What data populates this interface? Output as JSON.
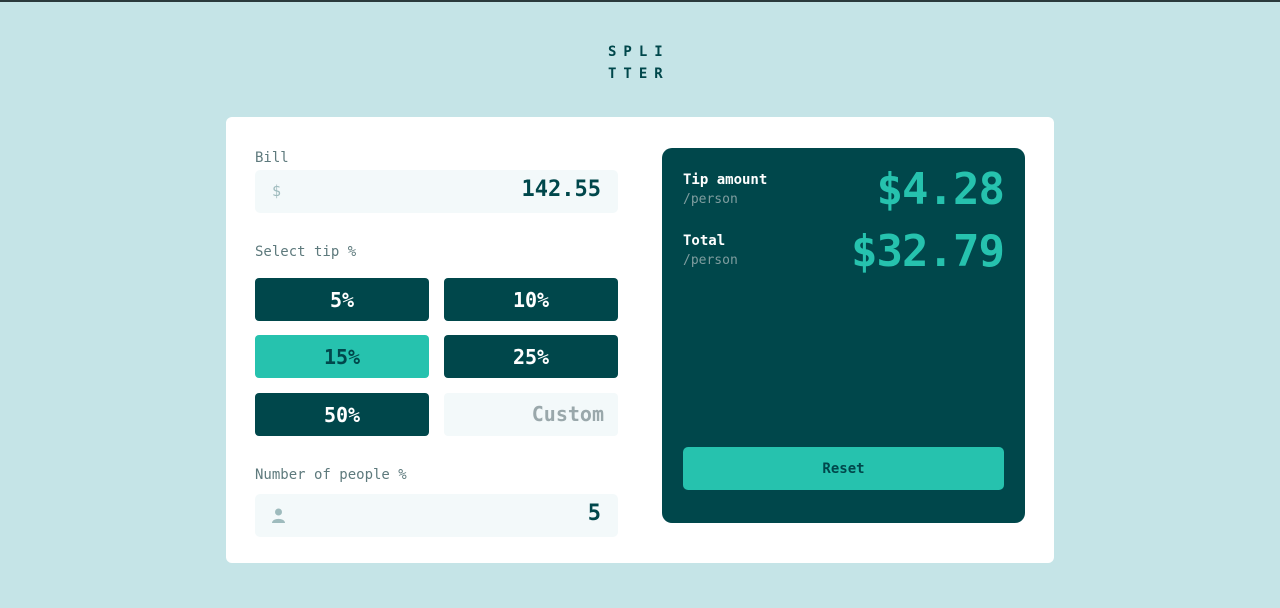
{
  "logo": {
    "line1": "SPLI",
    "line2": "TTER"
  },
  "bill": {
    "label": "Bill",
    "prefix": "$",
    "value": "142.55"
  },
  "tip": {
    "label": "Select tip %",
    "options": [
      "5%",
      "10%",
      "15%",
      "25%",
      "50%"
    ],
    "selected": "15%",
    "custom_placeholder": "Custom"
  },
  "people": {
    "label": "Number of people %",
    "value": "5",
    "icon": "person-icon"
  },
  "results": {
    "tip_label": "Tip amount",
    "tip_sub": "/person",
    "tip_value": "$4.28",
    "total_label": "Total",
    "total_sub": "/person",
    "total_value": "$32.79",
    "reset_label": "Reset"
  },
  "colors": {
    "background": "#c5e4e7",
    "dark_cyan": "#00474b",
    "accent": "#26c2ae",
    "input_bg": "#f3f9fa"
  }
}
